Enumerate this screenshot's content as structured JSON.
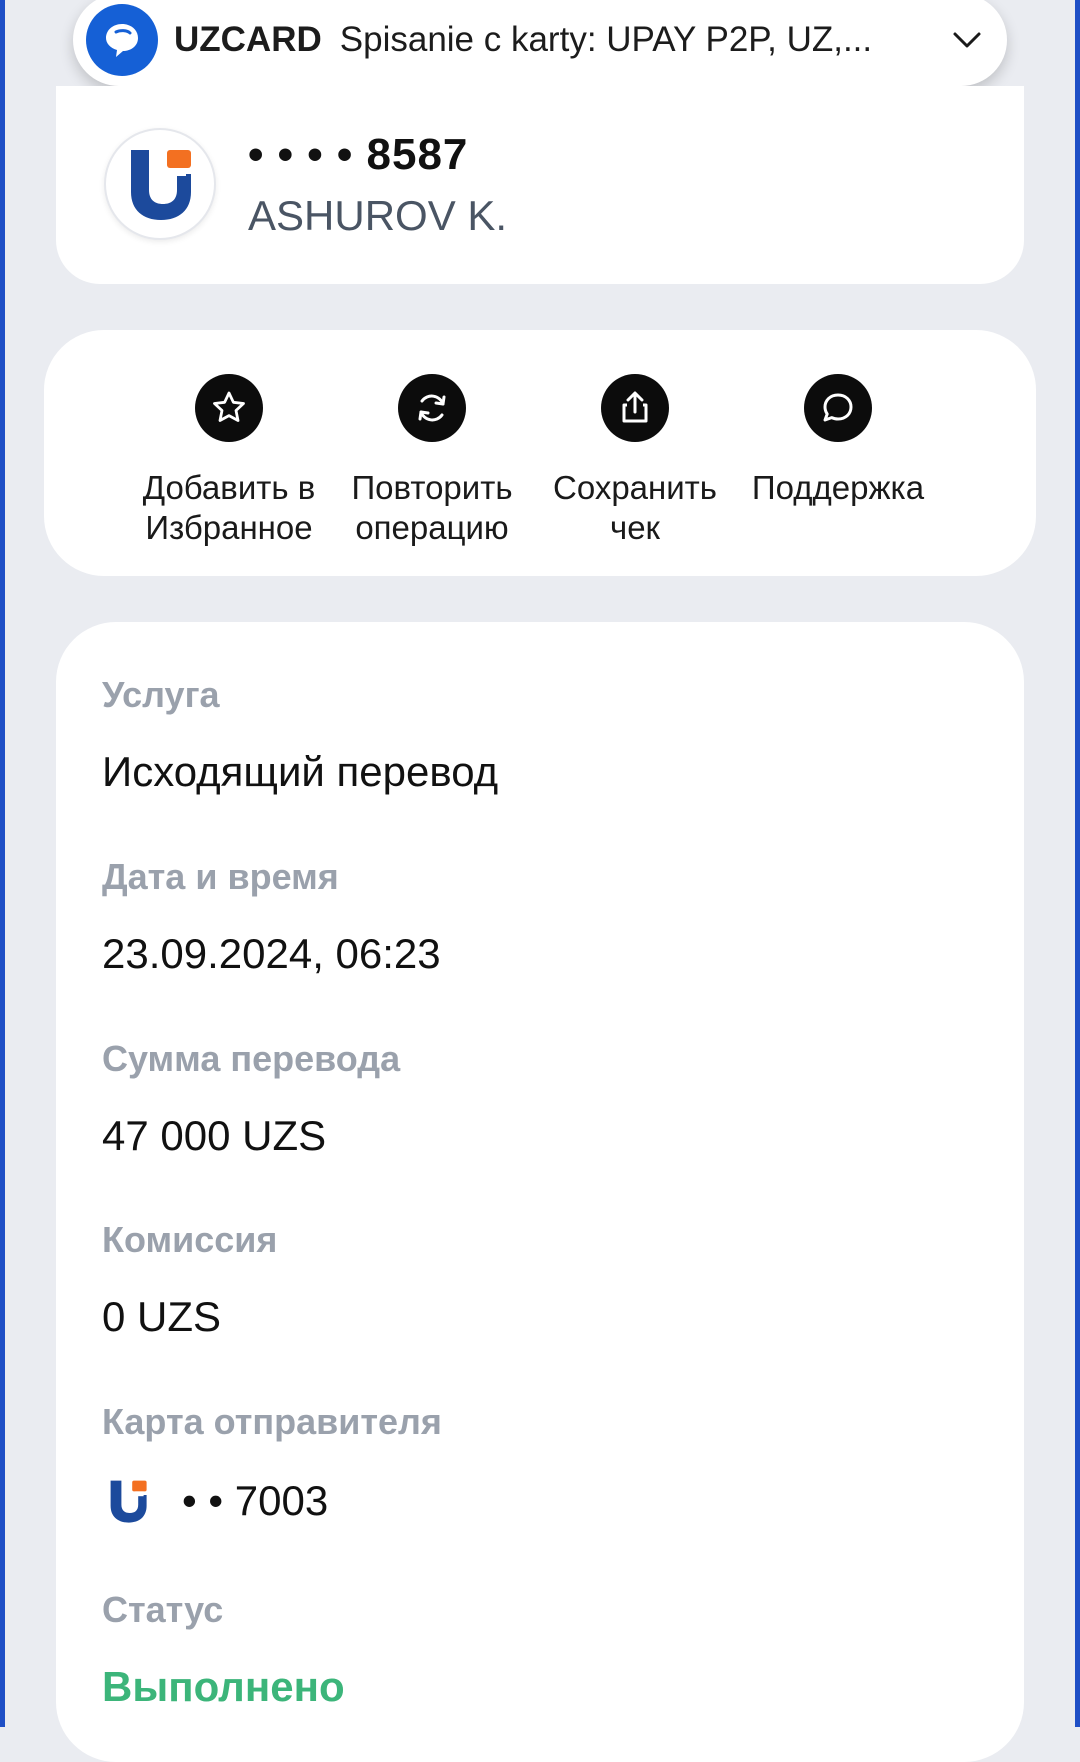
{
  "notification": {
    "brand": "UZCARD",
    "text": "Spisanie c karty: UPAY P2P, UZ,...",
    "icon": "chat-bubble-icon",
    "expand_icon": "chevron-down-icon"
  },
  "recipient": {
    "card_mask": "• • • • 8587",
    "name": "ASHUROV K.",
    "logo": "uzcard-logo"
  },
  "actions": [
    {
      "icon": "star-icon",
      "line1": "Добавить в",
      "line2": "Избранное"
    },
    {
      "icon": "repeat-icon",
      "line1": "Повторить",
      "line2": "операцию"
    },
    {
      "icon": "share-icon",
      "line1": "Сохранить",
      "line2": "чек"
    },
    {
      "icon": "chat-icon",
      "line1": "Поддержка",
      "line2": ""
    }
  ],
  "details": {
    "service_label": "Услуга",
    "service_value": "Исходящий перевод",
    "datetime_label": "Дата и время",
    "datetime_value": "23.09.2024, 06:23",
    "amount_label": "Сумма перевода",
    "amount_value": "47 000 UZS",
    "fee_label": "Комиссия",
    "fee_value": "0 UZS",
    "sender_label": "Карта отправителя",
    "sender_card": "• • 7003",
    "status_label": "Статус",
    "status_value": "Выполнено"
  },
  "colors": {
    "accent_blue": "#1560d6",
    "logo_blue": "#1c4a9c",
    "logo_orange": "#f37021",
    "status_green": "#3cb57a",
    "caption_gray": "#9aa1ac"
  }
}
